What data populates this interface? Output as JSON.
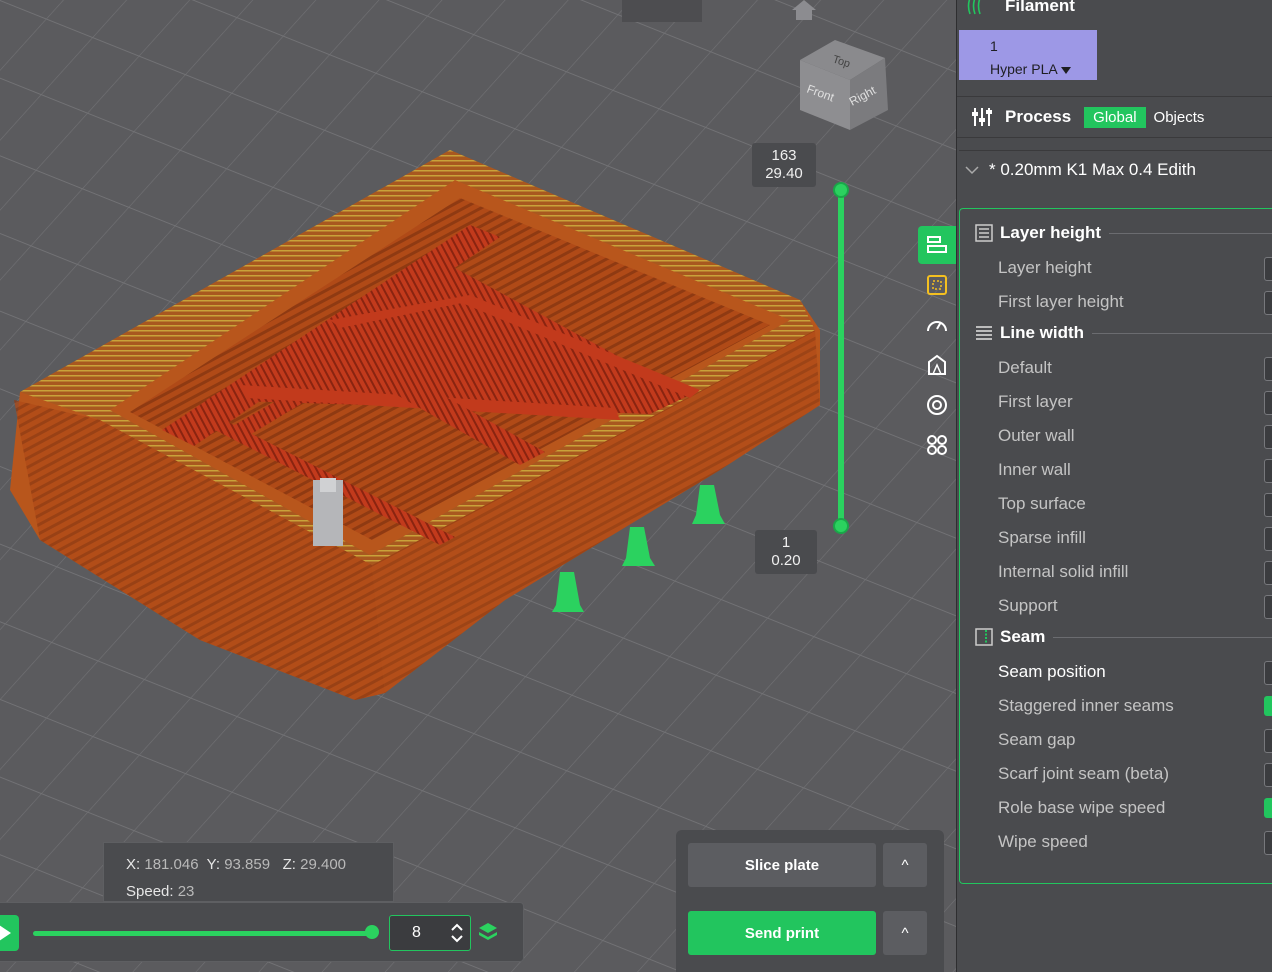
{
  "viewport": {
    "view_cube": {
      "top_label": "Top",
      "front_label": "Front",
      "right_label": "Right"
    },
    "layer_slider": {
      "top_layer": "163",
      "top_height": "29.40",
      "bottom_layer": "1",
      "bottom_height": "0.20"
    },
    "info": {
      "x_label": "X:",
      "x_value": "181.046",
      "y_label": "Y:",
      "y_value": "93.859",
      "z_label": "Z:",
      "z_value": "29.400",
      "speed_label": "Speed:",
      "speed_value": "23"
    },
    "move_slider": {
      "value": "8",
      "progress": 1.0
    },
    "toolbar_icons": [
      "layer-height-tool-icon",
      "support-paint-icon",
      "speed-gauge-icon",
      "seam-paint-icon",
      "measure-icon",
      "assembly-icon"
    ]
  },
  "actions": {
    "slice_label": "Slice plate",
    "send_label": "Send print",
    "caret_symbol": "^"
  },
  "sidebar": {
    "filament": {
      "title": "Filament",
      "slot_number": "1",
      "slot_name": "Hyper PLA",
      "slot_color": "#9d98e6"
    },
    "process": {
      "title": "Process",
      "global_tab": "Global",
      "objects_tab": "Objects",
      "preset": "* 0.20mm K1 Max 0.4 Edith"
    },
    "groups": {
      "layer_height": {
        "title": "Layer height",
        "options": [
          "Layer height",
          "First layer height"
        ]
      },
      "line_width": {
        "title": "Line width",
        "options": [
          "Default",
          "First layer",
          "Outer wall",
          "Inner wall",
          "Top surface",
          "Sparse infill",
          "Internal solid infill",
          "Support"
        ]
      },
      "seam": {
        "title": "Seam",
        "options": [
          "Seam position",
          "Staggered inner seams",
          "Seam gap",
          "Scarf joint seam (beta)",
          "Role base wipe speed",
          "Wipe speed"
        ]
      }
    }
  },
  "colors": {
    "accent": "#22c55e",
    "model": "#b8561c",
    "panel": "#4a4b4e",
    "plate": "#5b5b5e"
  }
}
